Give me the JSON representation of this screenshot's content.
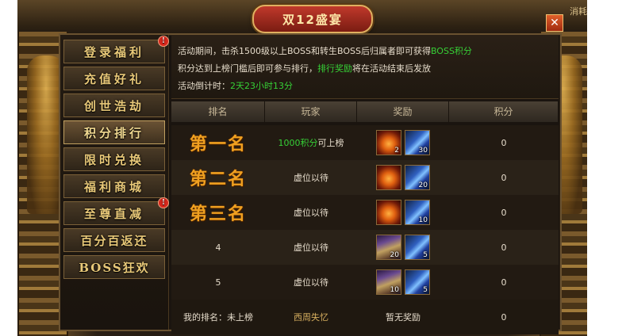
{
  "window": {
    "title": "双12盛宴",
    "close_label": "✕",
    "corner_text": "消耗"
  },
  "sidebar": {
    "items": [
      {
        "label": "登录福利",
        "badge": "!"
      },
      {
        "label": "充值好礼",
        "badge": ""
      },
      {
        "label": "创世浩劫",
        "badge": ""
      },
      {
        "label": "积分排行",
        "badge": ""
      },
      {
        "label": "限时兑换",
        "badge": ""
      },
      {
        "label": "福利商城",
        "badge": ""
      },
      {
        "label": "至尊直减",
        "badge": "!"
      },
      {
        "label": "百分百返还",
        "badge": ""
      },
      {
        "label": "BOSS狂欢",
        "badge": ""
      }
    ],
    "active_index": 3
  },
  "info": {
    "line1_a": "活动期间，击杀1500级以上BOSS和转生BOSS后归属者即可获得",
    "line1_b": "BOSS积分",
    "line2_a": "积分达到上榜门槛后即可参与排行，",
    "line2_b": "排行奖励",
    "line2_c": "将在活动结束后发放",
    "line3_a": "活动倒计时：",
    "line3_b": "2天23小时13分"
  },
  "table": {
    "headers": [
      "排名",
      "玩家",
      "奖励",
      "积分"
    ],
    "rows": [
      {
        "rank": "第一名",
        "player_a": "1000积分",
        "player_b": "可上榜",
        "items": [
          {
            "type": "potion",
            "count": "2"
          },
          {
            "type": "crystal",
            "count": "30"
          }
        ],
        "score": "0"
      },
      {
        "rank": "第二名",
        "player_a": "",
        "player_b": "虚位以待",
        "items": [
          {
            "type": "potion",
            "count": ""
          },
          {
            "type": "crystal",
            "count": "20"
          }
        ],
        "score": "0"
      },
      {
        "rank": "第三名",
        "player_a": "",
        "player_b": "虚位以待",
        "items": [
          {
            "type": "potion",
            "count": ""
          },
          {
            "type": "crystal",
            "count": "10"
          }
        ],
        "score": "0"
      },
      {
        "rank": "4",
        "player_a": "",
        "player_b": "虚位以待",
        "items": [
          {
            "type": "chest",
            "count": "20"
          },
          {
            "type": "crystal",
            "count": "5"
          }
        ],
        "score": "0"
      },
      {
        "rank": "5",
        "player_a": "",
        "player_b": "虚位以待",
        "items": [
          {
            "type": "chest",
            "count": "10"
          },
          {
            "type": "crystal",
            "count": "5"
          }
        ],
        "score": "0"
      }
    ],
    "footer": {
      "my_rank": "我的排名：未上榜",
      "player": "西周失忆",
      "reward": "暂无奖励",
      "score": "0"
    }
  },
  "colors": {
    "accent_green": "#36d036",
    "rank_gold": "#f0a020",
    "title_red": "#c0392b"
  }
}
